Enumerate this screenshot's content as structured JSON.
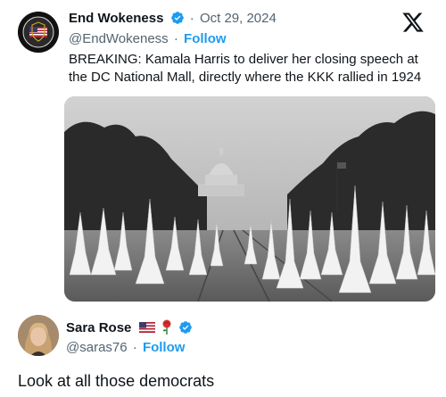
{
  "main_post": {
    "author_name": "End Wokeness",
    "date": "Oct 29, 2024",
    "handle": "@EndWokeness",
    "follow_label": "Follow",
    "text": "BREAKING: Kamala Harris to deliver her closing speech at the DC National Mall, directly where the KKK rallied in 1924",
    "avatar_text_top": "I SUPPORT THE",
    "avatar_text_bottom": "BORDER PATROL",
    "media": {
      "type": "photo",
      "description_icon": "historic-photo"
    }
  },
  "reply_post": {
    "author_name": "Sara Rose",
    "handle": "@saras76",
    "follow_label": "Follow",
    "text": "Look at all those democrats"
  },
  "colors": {
    "accent": "#1d9bf0",
    "secondary_text": "#536471",
    "primary_text": "#0f1419",
    "verified": "#1d9bf0"
  }
}
